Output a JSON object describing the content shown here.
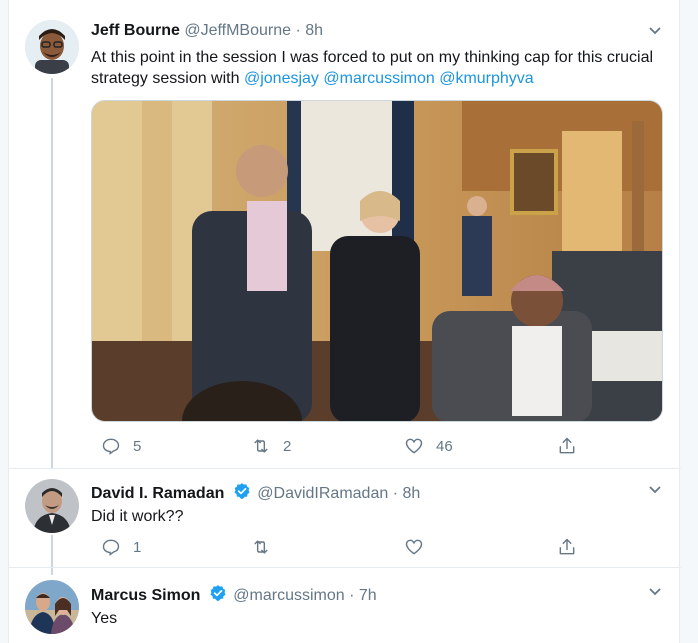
{
  "tweets": [
    {
      "name": "Jeff Bourne",
      "handle": "@JeffMBourne",
      "time": "8h",
      "verified": false,
      "text_plain": "At this point in the session I was forced to put on my thinking cap for this crucial strategy session with",
      "mentions": [
        "@jonesjay",
        "@marcussimon",
        "@kmurphyva"
      ],
      "replies": "5",
      "retweets": "2",
      "likes": "46"
    },
    {
      "name": "David I. Ramadan",
      "handle": "@DavidIRamadan",
      "time": "8h",
      "verified": true,
      "text_plain": "Did it work??",
      "replies": "1",
      "retweets": "",
      "likes": ""
    },
    {
      "name": "Marcus Simon",
      "handle": "@marcussimon",
      "time": "7h",
      "verified": true,
      "text_plain": "Yes"
    }
  ],
  "separator": "·",
  "colors": {
    "link": "#1b95e0",
    "muted": "#657786",
    "verified": "#1da1f2",
    "border": "#e6ecf0"
  },
  "icons": [
    "reply-icon",
    "retweet-icon",
    "like-icon",
    "share-icon",
    "chevron-down-icon",
    "verified-badge-icon"
  ]
}
